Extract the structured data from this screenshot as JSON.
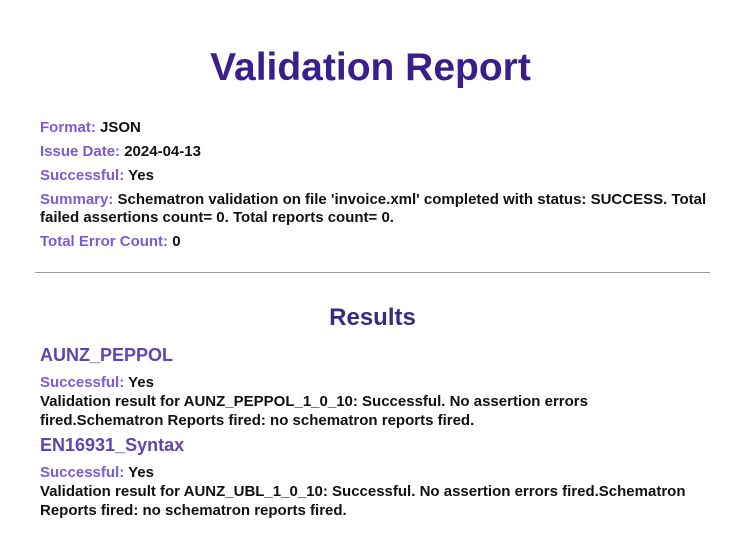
{
  "report": {
    "title": "Validation Report",
    "format_label": "Format:",
    "format_value": "JSON",
    "issue_date_label": "Issue Date:",
    "issue_date_value": "2024-04-13",
    "successful_label": "Successful:",
    "successful_value": "Yes",
    "summary_label": "Summary:",
    "summary_value": "Schematron validation on file 'invoice.xml' completed with status: SUCCESS. Total failed assertions count= 0. Total reports count= 0.",
    "total_error_label": "Total Error Count:",
    "total_error_value": "0"
  },
  "results": {
    "title": "Results",
    "items": [
      {
        "name": "AUNZ_PEPPOL",
        "successful_label": "Successful:",
        "successful_value": "Yes",
        "message": "Validation result for AUNZ_PEPPOL_1_0_10: Successful. No assertion errors fired.Schematron Reports fired: no schematron reports fired."
      },
      {
        "name": "EN16931_Syntax",
        "successful_label": "Successful:",
        "successful_value": "Yes",
        "message": "Validation result for AUNZ_UBL_1_0_10: Successful. No assertion errors fired.Schematron Reports fired: no schematron reports fired."
      }
    ]
  },
  "colors": {
    "title": "#3a1e8c",
    "label": "#7b5bd6",
    "result_name": "#5f45b0",
    "divider": "#9a9a9a"
  }
}
